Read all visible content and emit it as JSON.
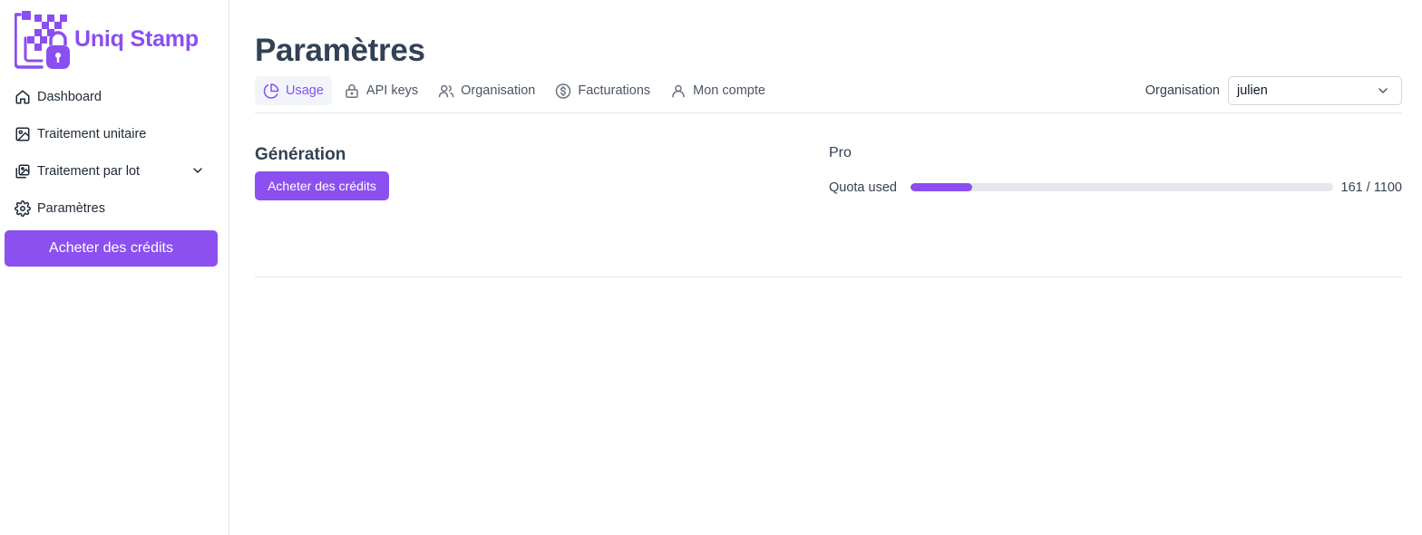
{
  "brand": {
    "name": "Uniq Stamp",
    "color": "#8b4ef0"
  },
  "sidebar": {
    "items": [
      {
        "label": "Dashboard",
        "icon": "home-icon"
      },
      {
        "label": "Traitement unitaire",
        "icon": "image-icon"
      },
      {
        "label": "Traitement par lot",
        "icon": "images-icon",
        "expandable": true
      },
      {
        "label": "Paramètres",
        "icon": "gear-icon"
      }
    ],
    "buy_label": "Acheter des crédits"
  },
  "page": {
    "title": "Paramètres"
  },
  "tabs": [
    {
      "label": "Usage",
      "icon": "pie-chart-icon",
      "active": true
    },
    {
      "label": "API keys",
      "icon": "lock-icon",
      "active": false
    },
    {
      "label": "Organisation",
      "icon": "users-icon",
      "active": false
    },
    {
      "label": "Facturations",
      "icon": "dollar-circle-icon",
      "active": false
    },
    {
      "label": "Mon compte",
      "icon": "user-icon",
      "active": false
    }
  ],
  "organisation": {
    "label": "Organisation",
    "selected": "julien"
  },
  "generation": {
    "title": "Génération",
    "buy_label": "Acheter des crédits"
  },
  "plan": {
    "name": "Pro",
    "quota_label": "Quota used",
    "used": 161,
    "total": 1100,
    "quota_text": "161 / 1100"
  }
}
